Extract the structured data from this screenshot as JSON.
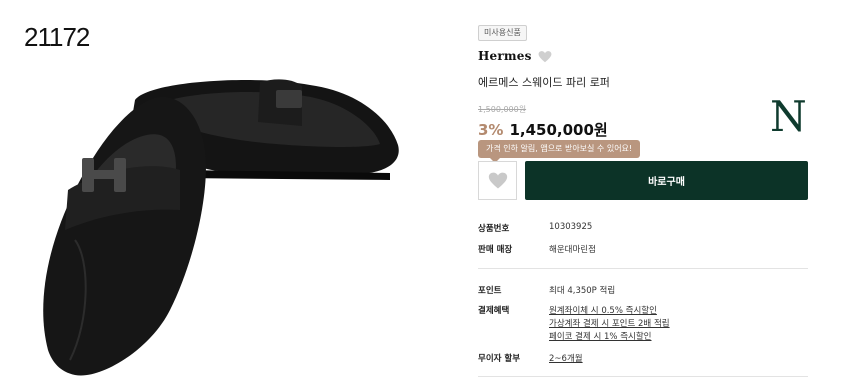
{
  "product_code": "21172",
  "badge": "미사용신품",
  "brand": "Hermes",
  "product_name": "에르메스 스웨이드 파리 로퍼",
  "original_price": "1,500,000원",
  "discount": "3%",
  "price": "1,450,000원",
  "store_logo": "N",
  "tooltip": "가격 인하 알림, 앱으로 받아보실 수 있어요!",
  "buy_label": "바로구매",
  "specs": {
    "product_no_label": "상품번호",
    "product_no": "10303925",
    "store_label": "판매 매장",
    "store": "해운대마린점",
    "points_label": "포인트",
    "points": "최대 4,350P 적립",
    "benefits_label": "결제혜택",
    "benefits": [
      "원계좌이체 시 0.5% 즉시할인",
      "가상계좌 결제 시 포인트 2배 적립",
      "페이코 결제 시 1% 즉시할인"
    ],
    "installment_label": "무이자 할부",
    "installment": "2~6개월"
  },
  "colors": {
    "buy_button": "#0c3327",
    "discount": "#b38a6f",
    "tooltip": "#b9967f",
    "logo": "#0f3b2e"
  },
  "icons": {
    "brand_heart": "heart-icon",
    "wish": "heart-icon"
  }
}
